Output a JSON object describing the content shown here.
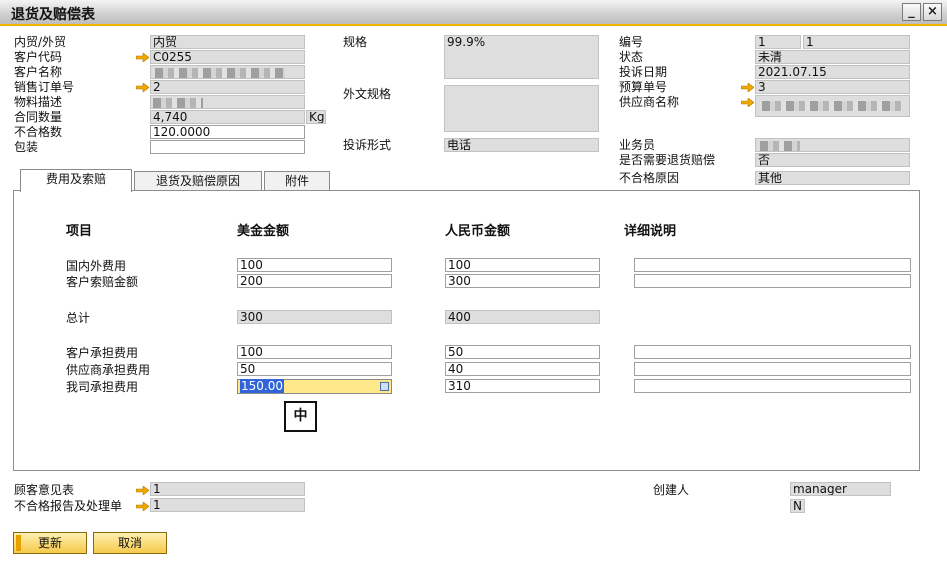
{
  "window": {
    "title": "退货及赔偿表",
    "minimize_glyph": "_",
    "close_glyph": "×"
  },
  "header": {
    "trade_type_label": "内贸/外贸",
    "trade_type_value": "内贸",
    "customer_code_label": "客户代码",
    "customer_code_value": "C0255",
    "customer_name_label": "客户名称",
    "sales_order_label": "销售订单号",
    "sales_order_value": "2",
    "item_desc_label": "物料描述",
    "contract_qty_label": "合同数量",
    "contract_qty_value": "4,740",
    "contract_qty_unit": "Kg",
    "nonconform_qty_label": "不合格数",
    "nonconform_qty_value": "120.0000",
    "packing_label": "包装",
    "spec_label": "规格",
    "spec_value": "99.9%",
    "foreign_spec_label": "外文规格",
    "complaint_form_label": "投诉形式",
    "complaint_form_value": "电话",
    "number_label": "编号",
    "number_series_value": "1",
    "number_value": "1",
    "status_label": "状态",
    "status_value": "未清",
    "complaint_date_label": "投诉日期",
    "complaint_date_value": "2021.07.15",
    "budget_no_label": "预算单号",
    "budget_no_value": "3",
    "supplier_name_label": "供应商名称",
    "salesperson_label": "业务员",
    "return_comp_label": "是否需要退货赔偿",
    "return_comp_value": "否",
    "nonconform_reason_label": "不合格原因",
    "nonconform_reason_value": "其他"
  },
  "tabs": [
    {
      "label": "费用及索赔",
      "active": true
    },
    {
      "label": "退货及赔偿原因",
      "active": false
    },
    {
      "label": "附件",
      "active": false
    }
  ],
  "grid": {
    "col_item": "项目",
    "col_usd": "美金金额",
    "col_rmb": "人民币金额",
    "col_detail": "详细说明",
    "rows": [
      {
        "label": "国内外费用",
        "usd": "100",
        "rmb": "100"
      },
      {
        "label": "客户索赔金额",
        "usd": "200",
        "rmb": "300"
      },
      {
        "label": "总计",
        "usd": "300",
        "rmb": "400"
      },
      {
        "label": "客户承担费用",
        "usd": "100",
        "rmb": "50"
      },
      {
        "label": "供应商承担费用",
        "usd": "50",
        "rmb": "40"
      },
      {
        "label": "我司承担费用",
        "usd": "150.00",
        "rmb": "310"
      }
    ],
    "ime_indicator": "中"
  },
  "footer": {
    "customer_feedback_label": "顾客意见表",
    "customer_feedback_value": "1",
    "nonconform_report_label": "不合格报告及处理单",
    "nonconform_report_value": "1",
    "creator_label": "创建人",
    "creator_value": "manager",
    "creator_flag": "N"
  },
  "buttons": {
    "update_label": "更新",
    "cancel_label": "取消"
  },
  "colors": {
    "accent": "#f0b400",
    "readonly_bg": "#dedede",
    "selection": "#3064d8",
    "active_field": "#ffe88a"
  }
}
